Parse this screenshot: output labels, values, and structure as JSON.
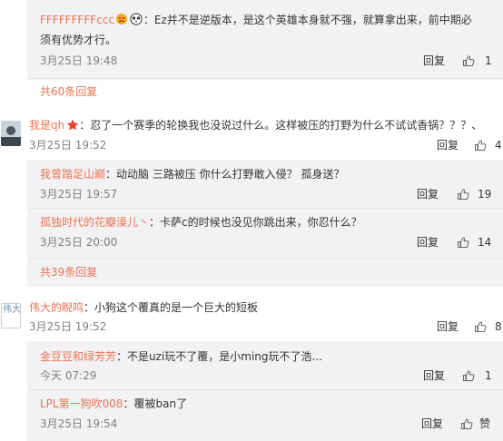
{
  "c1": {
    "user": "FFFFFFFFFccc",
    "text_line1": "：Ez并不是逆版本，是这个英雄本身就不强，就算拿出来，前中期必",
    "text_line2": "须有优势才行。",
    "time": "3月25日 19:48",
    "reply": "回复",
    "likes": "1"
  },
  "more1": "共60条回复",
  "c2": {
    "user": "我是qh",
    "text": "：忍了一个赛季的轮换我也没说过什么。这样被压的打野为什么不试试香锅？？？、",
    "time": "3月25日 19:52",
    "reply": "回复",
    "likes": "4"
  },
  "c2r1": {
    "user": "我曾踏足山巅",
    "text": "：动动脑 三路被压 你什么打野敢入侵？ 孤身送？",
    "time": "3月25日 19:57",
    "reply": "回复",
    "likes": "19"
  },
  "c2r2": {
    "user": "孤独时代的花瓣澡儿丶",
    "text": "：卡萨c的时候也没见你跳出来，你忍什么？",
    "time": "3月25日 20:00",
    "reply": "回复",
    "likes": "14"
  },
  "more2": "共39条回复",
  "c3": {
    "avatar_alt": "伟大",
    "user": "伟大的睨鸣",
    "text": "：小狗这个覆真的是一个巨大的短板",
    "time": "3月25日 19:52",
    "reply": "回复",
    "likes": "8"
  },
  "c3r1": {
    "user": "金豆豆和绿芳芳",
    "text": "：不是uzi玩不了覆，是小ming玩不了浩...",
    "time": "今天 07:29",
    "reply": "回复",
    "likes": "1"
  },
  "c3r2": {
    "user": "LPL第一狗吹008",
    "text": "：覆被ban了",
    "time": "3月25日 19:54",
    "reply": "回复",
    "likes": "赞"
  },
  "colors": {
    "link": "#eb7350",
    "reply_bg": "#f2f2f5",
    "time": "#808080"
  },
  "icons": {
    "like": "thumb-up-icon",
    "emoji1": "angry-emoji-icon",
    "emoji2": "panda-emoji-icon",
    "vip": "star-badge-icon"
  }
}
